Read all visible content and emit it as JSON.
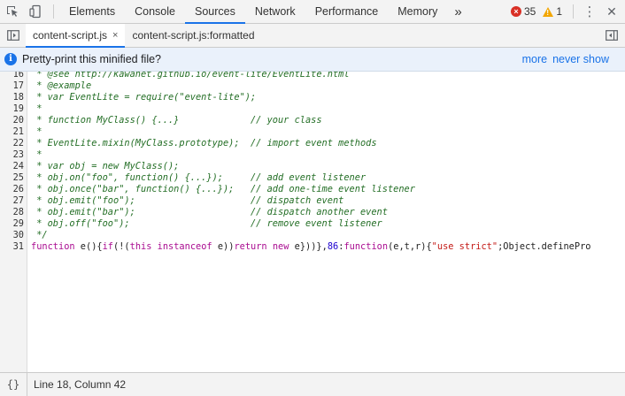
{
  "toolbar": {
    "tabs": [
      "Elements",
      "Console",
      "Sources",
      "Network",
      "Performance",
      "Memory"
    ],
    "active_tab": "Sources",
    "more_glyph": "»",
    "error_count": "35",
    "warning_count": "1",
    "error_glyph": "×",
    "warning_glyph": "!",
    "kebab_glyph": "⋮",
    "close_glyph": "✕",
    "icons": [
      "inspect-element-icon",
      "device-toolbar-icon",
      "more-tabs-icon",
      "error-icon",
      "warning-icon",
      "kebab-menu-icon",
      "close-icon"
    ]
  },
  "file_tabs": {
    "tabs": [
      "content-script.js",
      "content-script.js:formatted"
    ],
    "close_glyph": "×"
  },
  "infobar": {
    "info_glyph": "i",
    "message": "Pretty-print this minified file?",
    "links": [
      "more",
      "never show"
    ]
  },
  "code": {
    "first_line_partial": " * @see http://kawanet.github.io/event-lite/EventLite.html",
    "lines": [
      {
        "n": "16",
        "segments": [
          {
            "c": "cm",
            "t": " * @see http://kawanet.github.io/event-lite/EventLite.html"
          }
        ]
      },
      {
        "n": "17",
        "segments": [
          {
            "c": "cm",
            "t": " * @example"
          }
        ]
      },
      {
        "n": "18",
        "segments": [
          {
            "c": "cm",
            "t": " * var EventLite = require(\"event-lite\");"
          }
        ]
      },
      {
        "n": "19",
        "segments": [
          {
            "c": "cm",
            "t": " *"
          }
        ]
      },
      {
        "n": "20",
        "segments": [
          {
            "c": "cm",
            "t": " * function MyClass() {...}             // your class"
          }
        ]
      },
      {
        "n": "21",
        "segments": [
          {
            "c": "cm",
            "t": " *"
          }
        ]
      },
      {
        "n": "22",
        "segments": [
          {
            "c": "cm",
            "t": " * EventLite.mixin(MyClass.prototype);  // import event methods"
          }
        ]
      },
      {
        "n": "23",
        "segments": [
          {
            "c": "cm",
            "t": " *"
          }
        ]
      },
      {
        "n": "24",
        "segments": [
          {
            "c": "cm",
            "t": " * var obj = new MyClass();"
          }
        ]
      },
      {
        "n": "25",
        "segments": [
          {
            "c": "cm",
            "t": " * obj.on(\"foo\", function() {...});     // add event listener"
          }
        ]
      },
      {
        "n": "26",
        "segments": [
          {
            "c": "cm",
            "t": " * obj.once(\"bar\", function() {...});   // add one-time event listener"
          }
        ]
      },
      {
        "n": "27",
        "segments": [
          {
            "c": "cm",
            "t": " * obj.emit(\"foo\");                     // dispatch event"
          }
        ]
      },
      {
        "n": "28",
        "segments": [
          {
            "c": "cm",
            "t": " * obj.emit(\"bar\");                     // dispatch another event"
          }
        ]
      },
      {
        "n": "29",
        "segments": [
          {
            "c": "cm",
            "t": " * obj.off(\"foo\");                      // remove event listener"
          }
        ]
      },
      {
        "n": "30",
        "segments": [
          {
            "c": "cm",
            "t": " */"
          }
        ]
      },
      {
        "n": "31",
        "segments": [
          {
            "c": "kw",
            "t": "function"
          },
          {
            "c": "plain",
            "t": " e(){"
          },
          {
            "c": "kw",
            "t": "if"
          },
          {
            "c": "plain",
            "t": "(!("
          },
          {
            "c": "kw",
            "t": "this instanceof"
          },
          {
            "c": "plain",
            "t": " e))"
          },
          {
            "c": "kw",
            "t": "return new"
          },
          {
            "c": "plain",
            "t": " e}))},"
          },
          {
            "c": "num",
            "t": "86"
          },
          {
            "c": "plain",
            "t": ":"
          },
          {
            "c": "kw",
            "t": "function"
          },
          {
            "c": "plain",
            "t": "(e,t,r){"
          },
          {
            "c": "str",
            "t": "\"use strict\""
          },
          {
            "c": "plain",
            "t": ";Object.definePro"
          }
        ]
      }
    ]
  },
  "status": {
    "braces_glyph": "{}",
    "cursor": "Line 18, Column 42"
  }
}
